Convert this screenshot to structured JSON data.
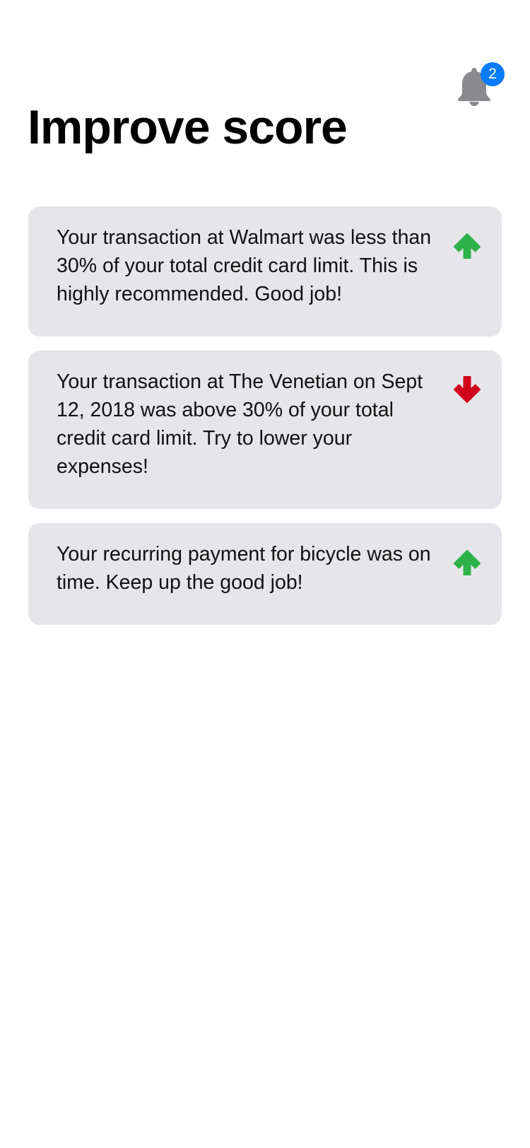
{
  "header": {
    "title": "Improve score",
    "notifications": {
      "icon": "bell-icon",
      "count": "2",
      "badge_color": "#0a7cff",
      "icon_color": "#8a8a8e"
    }
  },
  "cards": [
    {
      "text": "Your transaction at Walmart was less than 30% of your total credit card limit. This is highly recommended. Good job!",
      "trend": "up",
      "icon": "arrow-up-icon",
      "icon_color": "#2db24a"
    },
    {
      "text": "Your transaction at The Venetian on Sept 12, 2018 was above 30% of your total credit card limit. Try to lower your expenses!",
      "trend": "down",
      "icon": "arrow-down-icon",
      "icon_color": "#d0021b"
    },
    {
      "text": "Your recurring payment for bicycle was on time. Keep up the good job!",
      "trend": "up",
      "icon": "arrow-up-icon",
      "icon_color": "#2db24a"
    }
  ],
  "colors": {
    "background": "#ffffff",
    "card_background": "#e6e6ea",
    "text": "#111111"
  }
}
